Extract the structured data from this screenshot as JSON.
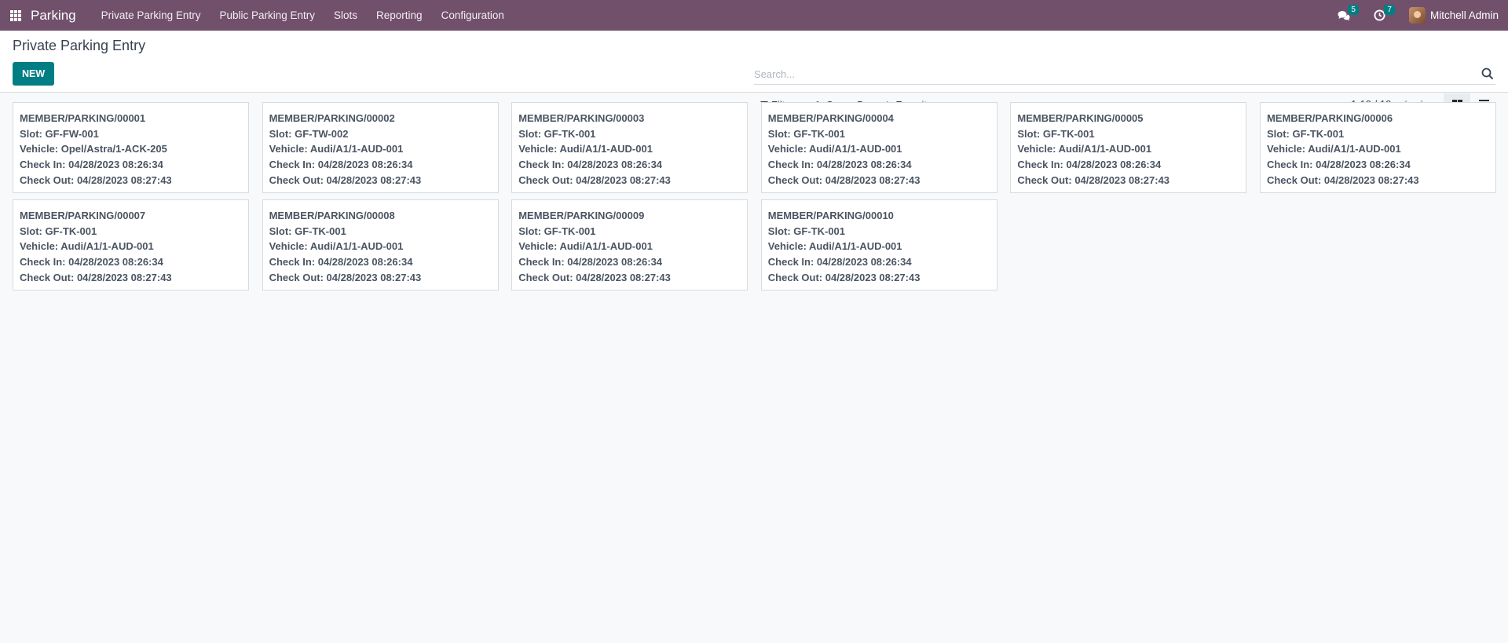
{
  "app": {
    "name": "Parking",
    "menu": [
      "Private Parking Entry",
      "Public Parking Entry",
      "Slots",
      "Reporting",
      "Configuration"
    ],
    "messages_count": "5",
    "activities_count": "7",
    "user_name": "Mitchell Admin",
    "accent": "#71506b"
  },
  "page": {
    "title": "Private Parking Entry",
    "new_label": "NEW",
    "search_placeholder": "Search...",
    "filters_label": "Filters",
    "groupby_label": "Group By",
    "favorites_label": "Favorites",
    "pager": "1-10 / 10"
  },
  "cards": [
    {
      "ref": "MEMBER/PARKING/00001",
      "slot": "Slot: GF-FW-001",
      "vehicle": "Vehicle: Opel/Astra/1-ACK-205",
      "checkin": "Check In: 04/28/2023 08:26:34",
      "checkout": "Check Out: 04/28/2023 08:27:43"
    },
    {
      "ref": "MEMBER/PARKING/00002",
      "slot": "Slot: GF-TW-002",
      "vehicle": "Vehicle: Audi/A1/1-AUD-001",
      "checkin": "Check In: 04/28/2023 08:26:34",
      "checkout": "Check Out: 04/28/2023 08:27:43"
    },
    {
      "ref": "MEMBER/PARKING/00003",
      "slot": "Slot: GF-TK-001",
      "vehicle": "Vehicle: Audi/A1/1-AUD-001",
      "checkin": "Check In: 04/28/2023 08:26:34",
      "checkout": "Check Out: 04/28/2023 08:27:43"
    },
    {
      "ref": "MEMBER/PARKING/00004",
      "slot": "Slot: GF-TK-001",
      "vehicle": "Vehicle: Audi/A1/1-AUD-001",
      "checkin": "Check In: 04/28/2023 08:26:34",
      "checkout": "Check Out: 04/28/2023 08:27:43"
    },
    {
      "ref": "MEMBER/PARKING/00005",
      "slot": "Slot: GF-TK-001",
      "vehicle": "Vehicle: Audi/A1/1-AUD-001",
      "checkin": "Check In: 04/28/2023 08:26:34",
      "checkout": "Check Out: 04/28/2023 08:27:43"
    },
    {
      "ref": "MEMBER/PARKING/00006",
      "slot": "Slot: GF-TK-001",
      "vehicle": "Vehicle: Audi/A1/1-AUD-001",
      "checkin": "Check In: 04/28/2023 08:26:34",
      "checkout": "Check Out: 04/28/2023 08:27:43"
    },
    {
      "ref": "MEMBER/PARKING/00007",
      "slot": "Slot: GF-TK-001",
      "vehicle": "Vehicle: Audi/A1/1-AUD-001",
      "checkin": "Check In: 04/28/2023 08:26:34",
      "checkout": "Check Out: 04/28/2023 08:27:43"
    },
    {
      "ref": "MEMBER/PARKING/00008",
      "slot": "Slot: GF-TK-001",
      "vehicle": "Vehicle: Audi/A1/1-AUD-001",
      "checkin": "Check In: 04/28/2023 08:26:34",
      "checkout": "Check Out: 04/28/2023 08:27:43"
    },
    {
      "ref": "MEMBER/PARKING/00009",
      "slot": "Slot: GF-TK-001",
      "vehicle": "Vehicle: Audi/A1/1-AUD-001",
      "checkin": "Check In: 04/28/2023 08:26:34",
      "checkout": "Check Out: 04/28/2023 08:27:43"
    },
    {
      "ref": "MEMBER/PARKING/00010",
      "slot": "Slot: GF-TK-001",
      "vehicle": "Vehicle: Audi/A1/1-AUD-001",
      "checkin": "Check In: 04/28/2023 08:26:34",
      "checkout": "Check Out: 04/28/2023 08:27:43"
    }
  ]
}
